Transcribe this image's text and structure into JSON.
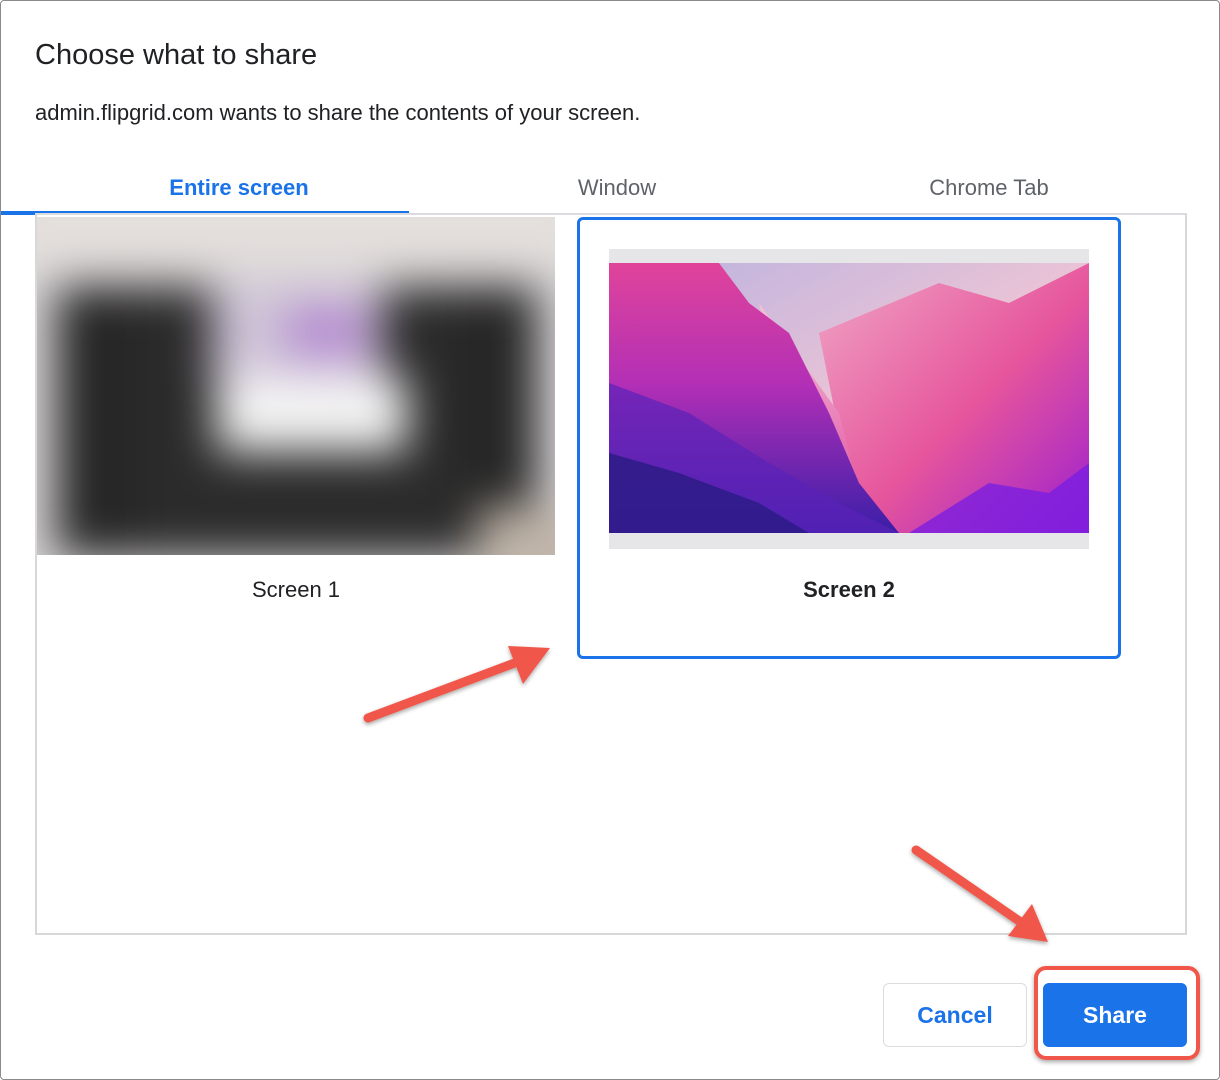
{
  "dialog": {
    "title": "Choose what to share",
    "subtitle": "admin.flipgrid.com wants to share the contents of your screen."
  },
  "tabs": [
    {
      "label": "Entire screen",
      "active": true
    },
    {
      "label": "Window",
      "active": false
    },
    {
      "label": "Chrome Tab",
      "active": false
    }
  ],
  "sources": [
    {
      "label": "Screen 1",
      "selected": false
    },
    {
      "label": "Screen 2",
      "selected": true
    }
  ],
  "buttons": {
    "cancel_label": "Cancel",
    "share_label": "Share"
  },
  "colors": {
    "accent": "#1a73e8",
    "annotation": "#f0574a"
  }
}
